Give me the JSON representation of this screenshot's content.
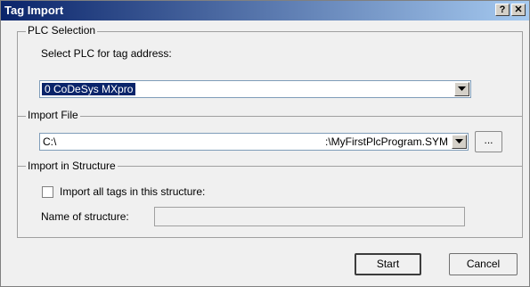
{
  "window": {
    "title": "Tag Import",
    "help_label": "?",
    "close_label": "✕"
  },
  "plc_selection": {
    "group_label": "PLC Selection",
    "select_label": "Select PLC for tag address:",
    "selected_value": "0   CoDeSys MXpro"
  },
  "import_file": {
    "group_label": "Import File",
    "path_start": "C:\\",
    "path_end": ":\\MyFirstPlcProgram.SYM",
    "browse_label": "..."
  },
  "import_structure": {
    "group_label": "Import in Structure",
    "checkbox_label": "Import all tags in this structure:",
    "checkbox_checked": false,
    "name_label": "Name of structure:",
    "name_value": ""
  },
  "footer": {
    "start_label": "Start",
    "cancel_label": "Cancel"
  }
}
